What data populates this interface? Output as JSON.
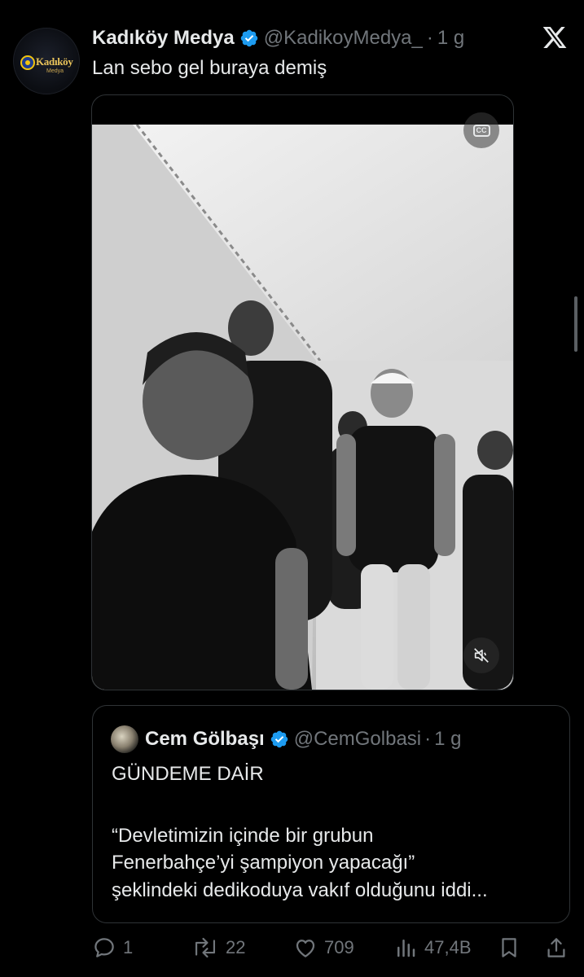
{
  "tweet": {
    "display_name": "Kadıköy Medya",
    "handle": "@KadikoyMedya_",
    "separator": "·",
    "time": "1 g",
    "text": "Lan sebo gel buraya demiş",
    "avatar_text": "Kadıköy",
    "avatar_subtext": "Medya",
    "verified_icon": "verified-badge-icon",
    "platform_icon": "x-logo-icon"
  },
  "media": {
    "cc_label": "CC",
    "cc_icon": "closed-captions-icon",
    "mute_icon": "speaker-muted-icon"
  },
  "quote": {
    "display_name": "Cem Gölbaşı",
    "handle": "@CemGolbasi",
    "separator": "·",
    "time": "1 g",
    "line1": "GÜNDEME DAİR",
    "line2": "“Devletimizin içinde bir grubun",
    "line3": "Fenerbahçe’yi şampiyon yapacağı”",
    "line4": "şeklindeki dedikoduya vakıf olduğunu iddi..."
  },
  "actions": {
    "reply_count": "1",
    "retweet_count": "22",
    "like_count": "709",
    "view_count": "47,4B",
    "icons": [
      "reply-icon",
      "retweet-icon",
      "like-icon",
      "views-icon",
      "bookmark-icon",
      "share-icon"
    ]
  },
  "colors": {
    "background": "#000000",
    "primary_text": "#e7e9ea",
    "secondary_text": "#71767b",
    "verified_blue": "#1d9bf0",
    "border": "#2f3336"
  }
}
